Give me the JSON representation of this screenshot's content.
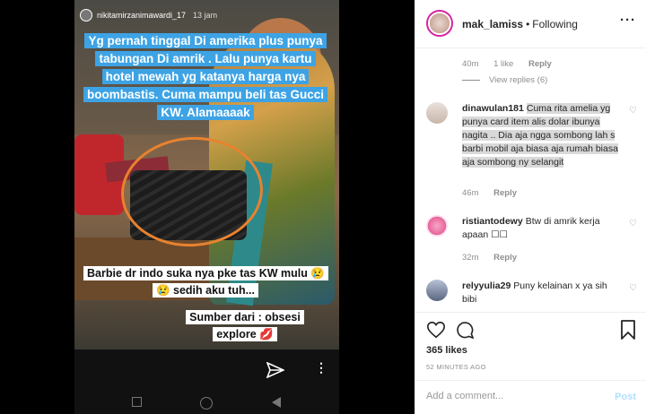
{
  "story": {
    "username": "nikitamirzanimawardi_17",
    "time": "13 jam",
    "caption_top": "Yg pernah tinggal Di amerika plus punya tabungan Di amrik . Lalu punya kartu hotel mewah yg katanya harga nya boombastis. Cuma mampu beli tas Gucci KW. Alamaaaak",
    "caption_mid": "Barbie dr indo suka nya pke tas KW mulu 😢😢 sedih aku tuh...",
    "caption_bottom": "Sumber dari : obsesi explore 💋",
    "more_glyph": "⋮"
  },
  "header": {
    "username": "mak_lamiss",
    "separator": "•",
    "follow_status": "Following",
    "more_glyph": "···"
  },
  "comments": {
    "first_meta": {
      "time": "40m",
      "likes": "1 like",
      "reply": "Reply"
    },
    "view_replies": "View replies (6)",
    "items": [
      {
        "username": "dinawulan181",
        "text": "Cuma rita amelia yg punya card item alis dolar ibunya nagita .. Dia aja ngga sombong lah s barbi mobil aja biasa aja rumah biasa aja sombong ny selangit",
        "time": "46m",
        "reply": "Reply",
        "heart": "♡"
      },
      {
        "username": "ristiantodewy",
        "text": "Btw di amrik kerja apaan ☐☐",
        "time": "32m",
        "reply": "Reply",
        "heart": "♡"
      },
      {
        "username": "relyyulia29",
        "text": "Puny kelainan x ya sih bibi",
        "time": "",
        "reply": "",
        "heart": "♡"
      }
    ]
  },
  "actions": {
    "likes": "365 likes",
    "time_ago": "52 MINUTES AGO"
  },
  "add_comment": {
    "placeholder": "Add a comment...",
    "post_label": "Post"
  }
}
